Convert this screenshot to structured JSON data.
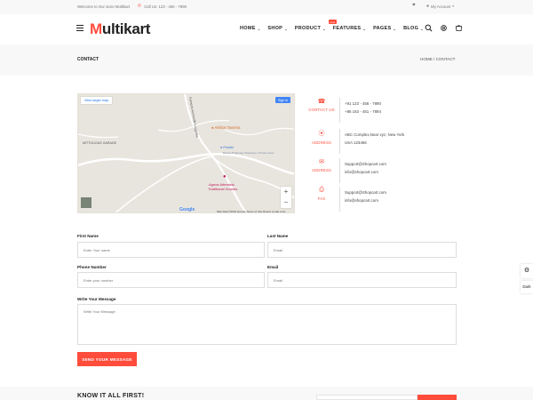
{
  "topbar": {
    "welcome": "Welcome to Our store Multikart",
    "phone": "Call Us: 123 - 456 - 7890",
    "account": "My Account"
  },
  "header": {
    "logo_initial": "M",
    "logo_rest": "ultikart",
    "nav": [
      {
        "label": "HOME"
      },
      {
        "label": "SHOP"
      },
      {
        "label": "PRODUCT"
      },
      {
        "label": "FEATURES"
      },
      {
        "label": "PAGES"
      },
      {
        "label": "BLOG"
      }
    ],
    "new_badge": "new"
  },
  "breadcrumb": {
    "page": "CONTACT",
    "trail": "HOME  /  CONTACT"
  },
  "map": {
    "view_larger": "View larger map",
    "sign_in": "Sign in",
    "google": "Google",
    "attribution": "Map data ©2019 Google     Terms of Use     Report a map error",
    "labels": {
      "garage": "MITTOLIGAS GARAGE",
      "road": "Kampos-Archontiki Loggeika",
      "taverna": "Arkhos Taverna",
      "pedaki": "Pedaki",
      "pedaki_sub": "Beauty Pharmacy Sistersein • Protein store",
      "agnos": "Agnos Artemisio",
      "agnos_sub": "Traditional Houses"
    }
  },
  "contact": {
    "rows": [
      {
        "icon": "☎",
        "label": "CONTACT US",
        "lines": [
          "+91 123 - 456 - 7890",
          "+86 163 - 451 - 7894"
        ]
      },
      {
        "icon": "⦿",
        "label": "ADDRESS",
        "lines": [
          "ABC Complex,Near xyz, New York",
          "USA 123456"
        ]
      },
      {
        "icon": "✉",
        "label": "ADDRESS",
        "lines": [
          "Support@Shopcart.com",
          "info@shopcart.com"
        ]
      },
      {
        "icon": "⎙",
        "label": "FAX",
        "lines": [
          "Support@Shopcart.com",
          "info@shopcart.com"
        ]
      }
    ]
  },
  "form": {
    "first_name_label": "First Name",
    "first_name_placeholder": "Enter Your name",
    "last_name_label": "Last Name",
    "last_name_placeholder": "Email",
    "phone_label": "Phone Number",
    "phone_placeholder": "Enter your number",
    "email_label": "Email",
    "email_placeholder": "Email",
    "message_label": "Write Your Message",
    "message_placeholder": "Write Your Message",
    "submit": "SEND YOUR MESSAGE"
  },
  "side": {
    "dark": "Dark"
  },
  "newsletter": {
    "title": "KNOW IT ALL FIRST!"
  },
  "colors": {
    "accent": "#ff4c3b"
  }
}
